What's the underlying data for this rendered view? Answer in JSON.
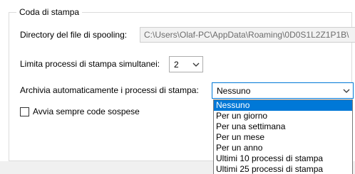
{
  "group": {
    "title": "Coda di stampa"
  },
  "spool": {
    "label": "Directory del file di spooling:",
    "value": "C:\\Users\\Olaf-PC\\AppData\\Roaming\\0D0S1L2Z1P1B\\"
  },
  "limit": {
    "label": "Limita processi di stampa simultanei:",
    "value": "2"
  },
  "archive": {
    "label": "Archivia automaticamente i processi di stampa:",
    "value": "Nessuno",
    "options": [
      "Nessuno",
      "Per un giorno",
      "Per una settimana",
      "Per un mese",
      "Per un anno",
      "Ultimi 10 processi di stampa",
      "Ultimi 25 processi di stampa"
    ],
    "selected_index": 0
  },
  "suspended": {
    "label": "Avvia sempre code sospese",
    "checked": false
  },
  "colors": {
    "accent": "#0078d7",
    "selection_text": "#ffffff"
  }
}
